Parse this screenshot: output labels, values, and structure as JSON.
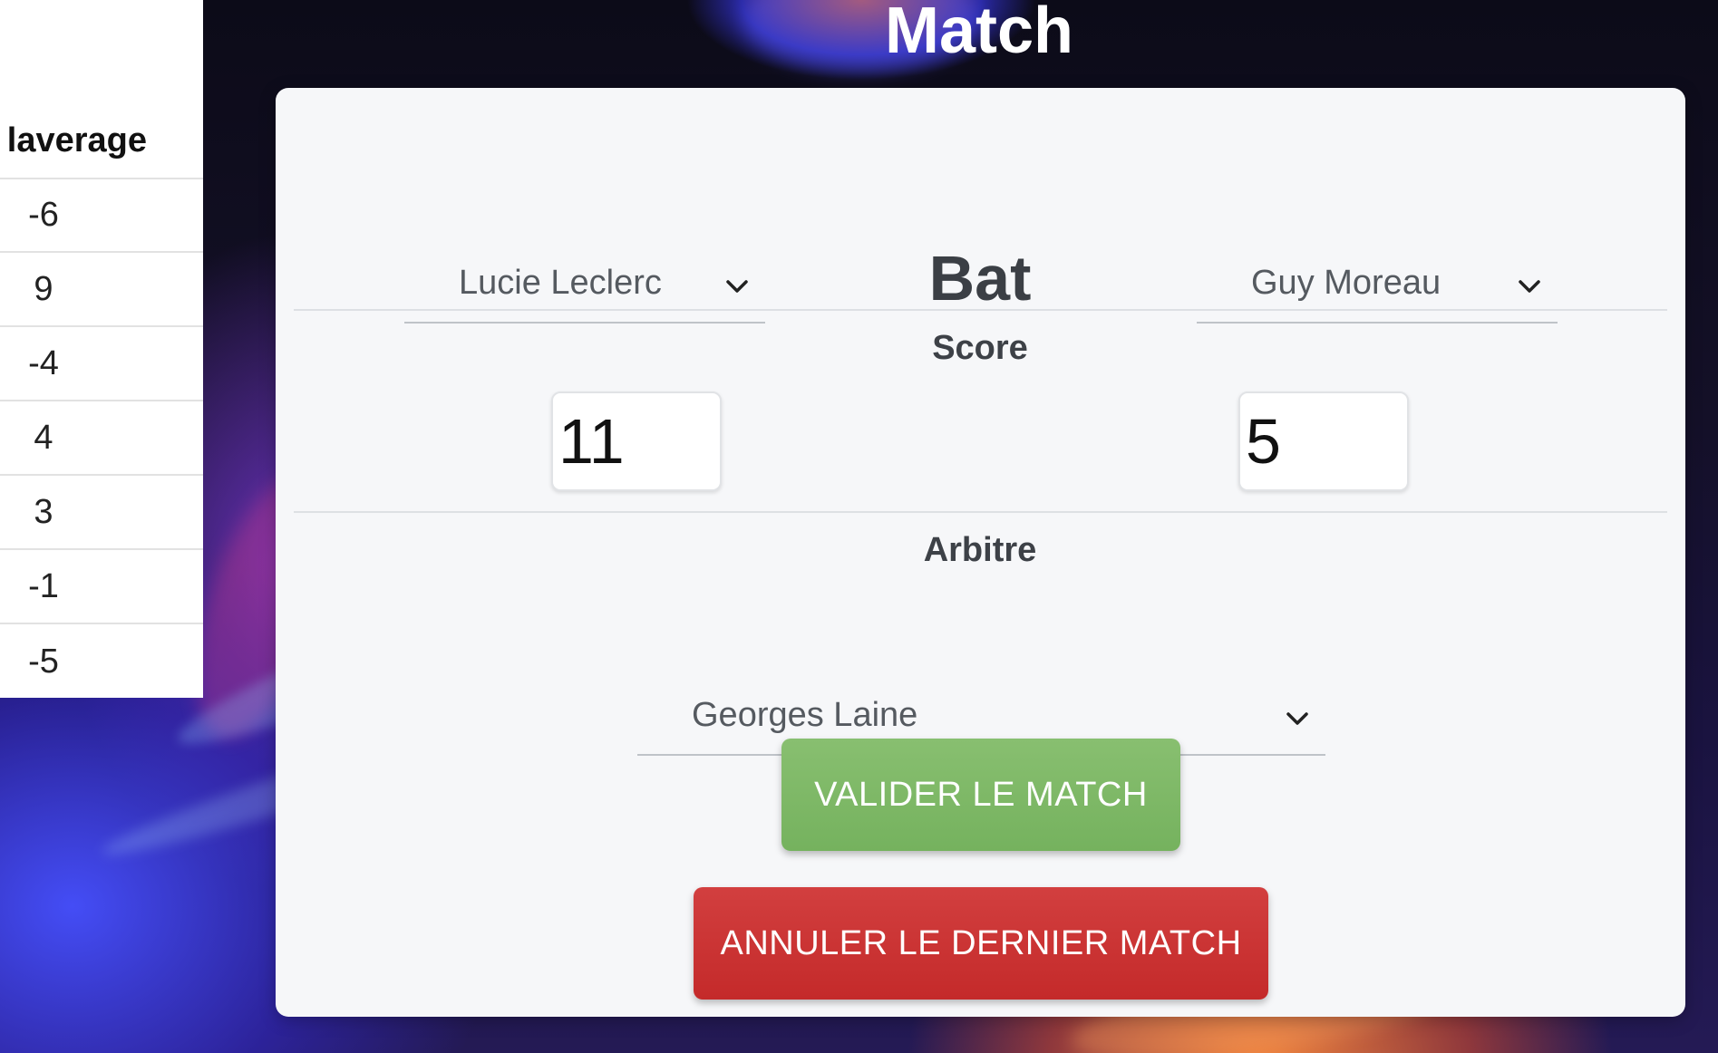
{
  "standings": {
    "column_header": "laverage",
    "values": [
      "-6",
      "9",
      "-4",
      "4",
      "3",
      "-1",
      "-5"
    ]
  },
  "match": {
    "title": "Match",
    "winner_select": {
      "value": "Lucie Leclerc",
      "icon": "chevron-down-icon"
    },
    "beats_label": "Bat",
    "loser_select": {
      "value": "Guy Moreau",
      "icon": "chevron-down-icon"
    },
    "score_label": "Score",
    "score_winner": "11",
    "score_loser": "5",
    "referee_label": "Arbitre",
    "referee_select": {
      "value": "Georges Laine",
      "icon": "chevron-down-icon"
    },
    "validate_button": "VALIDER LE MATCH",
    "cancel_button": "ANNULER LE DERNIER MATCH"
  },
  "colors": {
    "validate": "#7bb563",
    "cancel": "#c93232",
    "card_background": "#f6f7f9"
  }
}
